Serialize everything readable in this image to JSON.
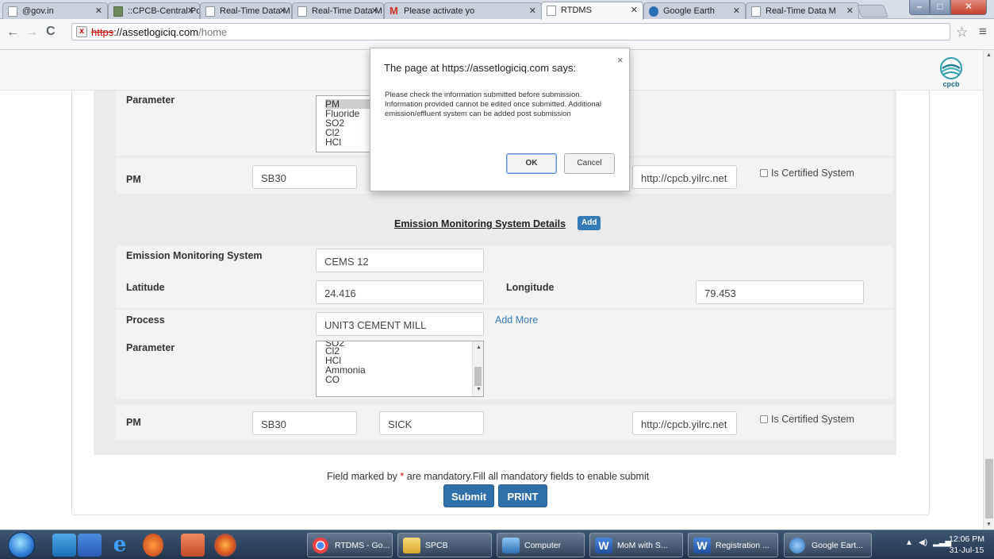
{
  "browser": {
    "tabs": [
      {
        "title": "@gov.in",
        "favicon": "page-icon"
      },
      {
        "title": "::CPCB-Central Po",
        "favicon": "cpcb-favicon"
      },
      {
        "title": "Real-Time Data M",
        "favicon": "page-icon"
      },
      {
        "title": "Real-Time Data M",
        "favicon": "page-icon"
      },
      {
        "title": "Please activate yo",
        "favicon": "gmail-icon"
      },
      {
        "title": "RTDMS",
        "favicon": "page-icon",
        "active": true
      },
      {
        "title": "Google Earth",
        "favicon": "google-earth-icon"
      },
      {
        "title": "Real-Time Data M",
        "favicon": "page-icon"
      }
    ],
    "url_scheme": "https",
    "url_host": "://assetlogiciq.com",
    "url_path": "/home",
    "insecure_marker": "x"
  },
  "header": {
    "logo_text": "cpcb"
  },
  "form": {
    "upper": {
      "parameter_label": "Parameter",
      "parameter_options": [
        "PM",
        "Fluoride",
        "SO2",
        "Cl2",
        "HCl"
      ],
      "parameter_selected": "PM",
      "pm_label": "PM",
      "pm_field1": "SB30",
      "pm_url": "http://cpcb.yilrc.net",
      "certified_label": "Is Certified System"
    },
    "section_title": "Emission Monitoring System Details",
    "add_button": "Add",
    "lower": {
      "ems_label": "Emission Monitoring System",
      "ems_value": "CEMS 12",
      "latitude_label": "Latitude",
      "latitude_value": "24.416",
      "longitude_label": "Longitude",
      "longitude_value": "79.453",
      "process_label": "Process",
      "process_value": "UNIT3 CEMENT MILL",
      "add_more_link": "Add More",
      "parameter_label": "Parameter",
      "parameter_options": [
        "SO2",
        "Cl2",
        "HCl",
        "Ammonia",
        "CO"
      ],
      "pm_label": "PM",
      "pm_field1": "SB30",
      "pm_field2": "SICK",
      "pm_url": "http://cpcb.yilrc.net",
      "certified_label": "Is Certified System"
    },
    "mandatory_note_pre": "Field marked by ",
    "mandatory_star": "*",
    "mandatory_note_post": " are mandatory.Fill all mandatory fields to enable submit",
    "submit_button": "Submit",
    "print_button": "PRINT"
  },
  "dialog": {
    "title": "The page at https://assetlogiciq.com says:",
    "message": "Please check the information submitted before submission. Information provided cannot be edited once submitted. Additional emission/effluent system can be added post submission",
    "ok": "OK",
    "cancel": "Cancel",
    "close": "×"
  },
  "taskbar": {
    "items": [
      {
        "label": "RTDMS - Go...",
        "icon": "chrome-icon"
      },
      {
        "label": "SPCB",
        "icon": "folder-icon"
      },
      {
        "label": "Computer",
        "icon": "computer-icon"
      },
      {
        "label": "MoM with S...",
        "icon": "word-icon"
      },
      {
        "label": "Registration ...",
        "icon": "word-icon"
      },
      {
        "label": "Google Eart...",
        "icon": "google-earth-icon"
      }
    ],
    "clock_time": "12:06 PM",
    "clock_date": "31-Jul-15"
  },
  "colors": {
    "primary_button": "#2f6faa",
    "link": "#337ab7",
    "required": "#dd0000"
  }
}
